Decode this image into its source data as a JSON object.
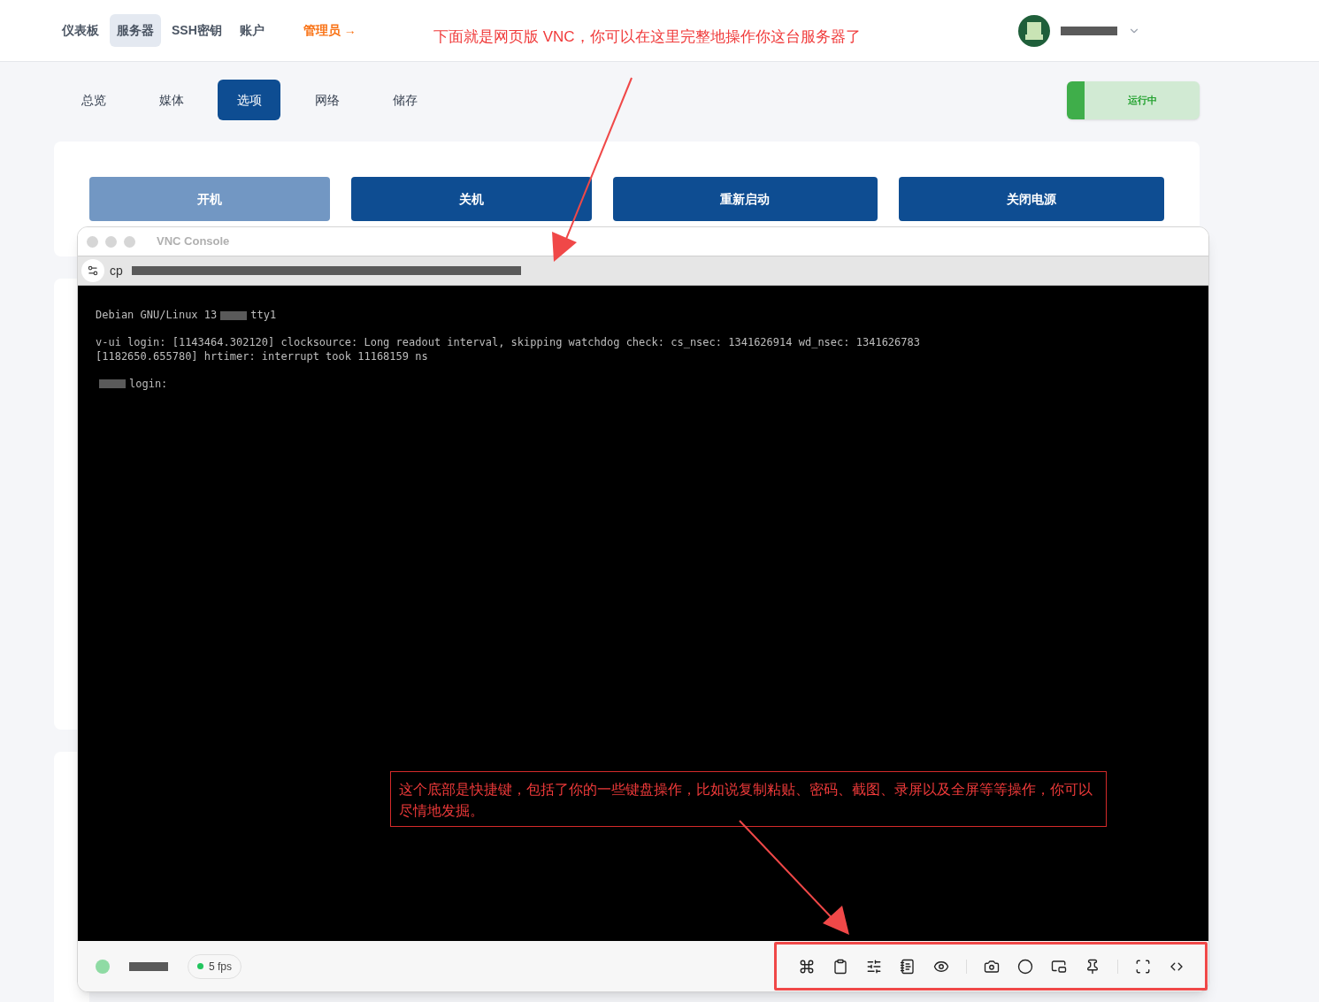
{
  "nav": {
    "items": [
      {
        "label": "仪表板",
        "selected": false
      },
      {
        "label": "服务器",
        "selected": true
      },
      {
        "label": "SSH密钥",
        "selected": false
      },
      {
        "label": "账户",
        "selected": false
      }
    ],
    "admin_link": "管理员 →"
  },
  "annotations": {
    "top": "下面就是网页版 VNC，你可以在这里完整地操作你这台服务器了",
    "bottom": "这个底部是快捷键，包括了你的一些键盘操作，比如说复制粘贴、密码、截图、录屏以及全屏等等操作，你可以尽情地发掘。"
  },
  "tabs": [
    {
      "label": "总览",
      "selected": false
    },
    {
      "label": "媒体",
      "selected": false
    },
    {
      "label": "选项",
      "selected": true
    },
    {
      "label": "网络",
      "selected": false
    },
    {
      "label": "储存",
      "selected": false
    }
  ],
  "status": {
    "label": "运行中",
    "running": true
  },
  "power_buttons": [
    {
      "label": "开机",
      "disabled": true
    },
    {
      "label": "关机",
      "disabled": false
    },
    {
      "label": "重新启动",
      "disabled": false
    },
    {
      "label": "关闭电源",
      "disabled": false
    }
  ],
  "vnc": {
    "title": "VNC Console",
    "address": "cp",
    "terminal": [
      {
        "kind": "split",
        "before": "Debian GNU/Linux 13",
        "after": "tty1"
      },
      {
        "kind": "blank"
      },
      {
        "kind": "text",
        "text": "v-ui login: [1143464.302120] clocksource: Long readout interval, skipping watchdog check: cs_nsec: 1341626914 wd_nsec: 1341626783"
      },
      {
        "kind": "text",
        "text": "[1182650.655780] hrtimer: interrupt took 11168159 ns"
      },
      {
        "kind": "blank"
      },
      {
        "kind": "split",
        "after": "login:"
      }
    ],
    "fps": {
      "label": "5 fps",
      "connected": true
    },
    "toolbar": [
      {
        "kind": "command"
      },
      {
        "kind": "clipboard"
      },
      {
        "kind": "sliders"
      },
      {
        "kind": "notes"
      },
      {
        "kind": "eye"
      },
      {
        "kind": "separator"
      },
      {
        "kind": "camera"
      },
      {
        "kind": "record"
      },
      {
        "kind": "pip"
      },
      {
        "kind": "pin"
      },
      {
        "kind": "separator"
      },
      {
        "kind": "fullscreen"
      },
      {
        "kind": "resize"
      }
    ]
  }
}
